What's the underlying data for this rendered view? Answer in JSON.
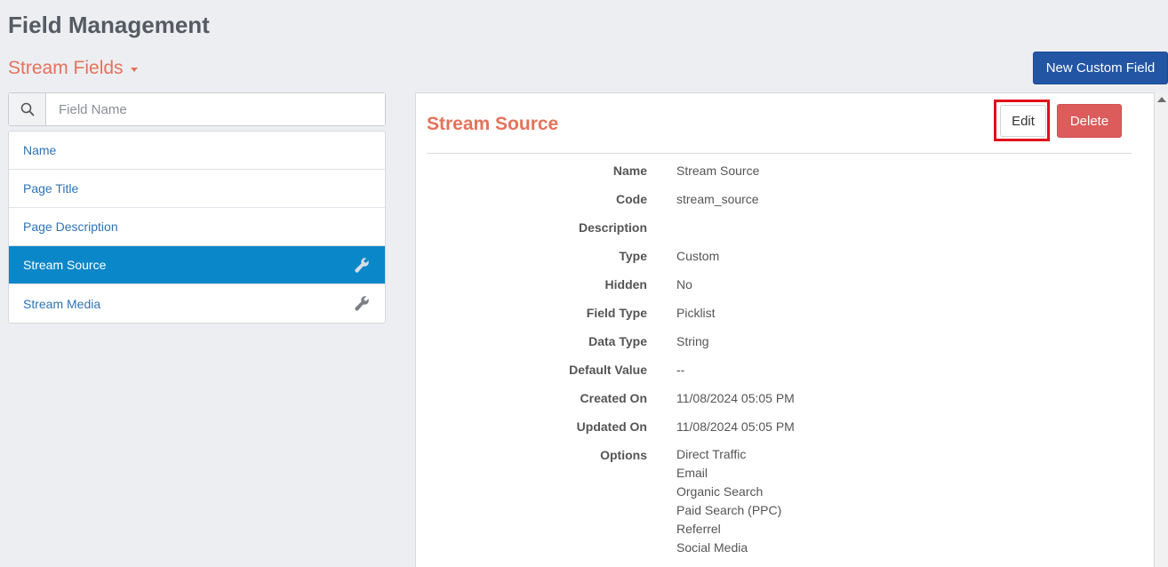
{
  "page": {
    "title": "Field Management"
  },
  "section": {
    "title": "Stream Fields"
  },
  "toolbar": {
    "new_button": "New Custom Field"
  },
  "search": {
    "placeholder": "Field Name"
  },
  "fields": [
    {
      "label": "Name"
    },
    {
      "label": "Page Title"
    },
    {
      "label": "Page Description"
    },
    {
      "label": "Stream Source"
    },
    {
      "label": "Stream Media"
    }
  ],
  "detail": {
    "title": "Stream Source",
    "edit_label": "Edit",
    "delete_label": "Delete",
    "rows": [
      {
        "label": "Name",
        "value": "Stream Source"
      },
      {
        "label": "Code",
        "value": "stream_source"
      },
      {
        "label": "Description",
        "value": ""
      },
      {
        "label": "Type",
        "value": "Custom"
      },
      {
        "label": "Hidden",
        "value": "No"
      },
      {
        "label": "Field Type",
        "value": "Picklist"
      },
      {
        "label": "Data Type",
        "value": "String"
      },
      {
        "label": "Default Value",
        "value": "--"
      },
      {
        "label": "Created On",
        "value": "11/08/2024 05:05 PM"
      },
      {
        "label": "Updated On",
        "value": "11/08/2024 05:05 PM"
      }
    ],
    "options_label": "Options",
    "options": [
      "Direct Traffic",
      "Email",
      "Organic Search",
      "Paid Search (PPC)",
      "Referrel",
      "Social Media"
    ]
  },
  "colors": {
    "accent": "#e5725a",
    "primary": "#2355a5",
    "active_item": "#0a87c9",
    "danger": "#dc5b5b",
    "highlight": "#e00d1b"
  },
  "icons": {
    "search": "search-icon",
    "field_tool": "wrench-icon",
    "dropdown": "caret-down-icon"
  }
}
